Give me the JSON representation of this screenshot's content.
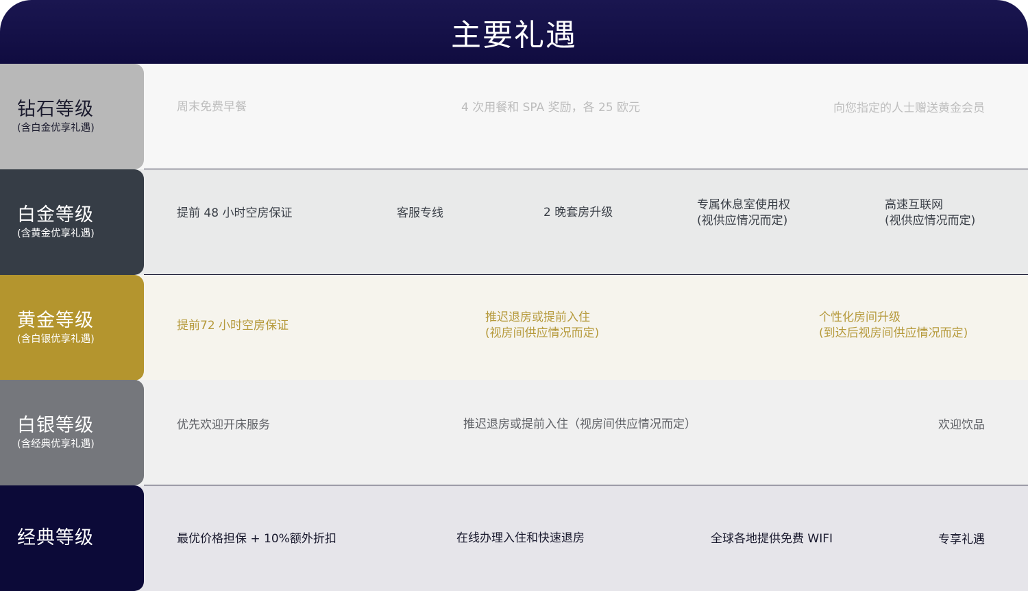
{
  "title": "主要礼遇",
  "tiers": {
    "diamond": {
      "name": "钻石等级",
      "sub": "(含白金优享礼遇)",
      "benefits": [
        "周末免费早餐",
        "4 次用餐和 SPA 奖励，各 25 欧元",
        "向您指定的人士赠送黄金会员"
      ]
    },
    "platinum": {
      "name": "白金等级",
      "sub": "(含黄金优享礼遇)",
      "benefits": [
        {
          "line1": "提前 48 小时空房保证"
        },
        {
          "line1": "客服专线"
        },
        {
          "line1": "2 晚套房升级"
        },
        {
          "line1": "专属休息室使用权",
          "line2": "(视供应情况而定)"
        },
        {
          "line1": "高速互联网",
          "line2": "(视供应情况而定)"
        }
      ]
    },
    "gold": {
      "name": "黄金等级",
      "sub": "(含白银优享礼遇)",
      "benefits": [
        {
          "line1": "提前72 小时空房保证"
        },
        {
          "line1": "推迟退房或提前入住",
          "line2": "(视房间供应情况而定)"
        },
        {
          "line1": "个性化房间升级",
          "line2": "(到达后视房间供应情况而定)"
        }
      ]
    },
    "silver": {
      "name": "白银等级",
      "sub": "(含经典优享礼遇)",
      "benefits": [
        "优先欢迎开床服务",
        "推迟退房或提前入住（视房间供应情况而定）",
        "欢迎饮品"
      ]
    },
    "classic": {
      "name": "经典等级",
      "benefits": [
        "最优价格担保 + 10%额外折扣",
        "在线办理入住和快速退房",
        "全球各地提供免费 WIFI",
        "专享礼遇"
      ]
    }
  }
}
